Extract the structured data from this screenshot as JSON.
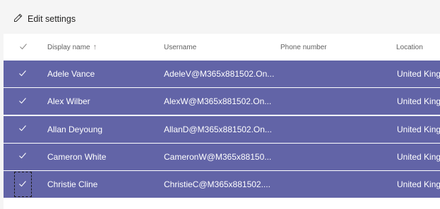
{
  "toolbar": {
    "edit_label": "Edit settings"
  },
  "columns": {
    "display_name": "Display name",
    "username": "Username",
    "phone": "Phone number",
    "location": "Location"
  },
  "rows": [
    {
      "name": "Adele Vance",
      "username": "AdeleV@M365x881502.On...",
      "phone": "",
      "location": "United Kinga"
    },
    {
      "name": "Alex Wilber",
      "username": "AlexW@M365x881502.On...",
      "phone": "",
      "location": "United Kinga"
    },
    {
      "name": "Allan Deyoung",
      "username": "AllanD@M365x881502.On...",
      "phone": "",
      "location": "United Kinga"
    },
    {
      "name": "Cameron White",
      "username": "CameronW@M365x88150...",
      "phone": "",
      "location": "United Kinga"
    },
    {
      "name": "Christie Cline",
      "username": "ChristieC@M365x881502....",
      "phone": "",
      "location": "United Kinga"
    }
  ],
  "icons": {
    "edit": "pencil-icon",
    "select_all": "checkmark-icon",
    "sort": "sort-ascending-icon",
    "row_check": "checkmark-icon"
  },
  "colors": {
    "selected_row": "#6264a7",
    "toolbar_bg": "#f5f5f5",
    "text": "#252423"
  }
}
